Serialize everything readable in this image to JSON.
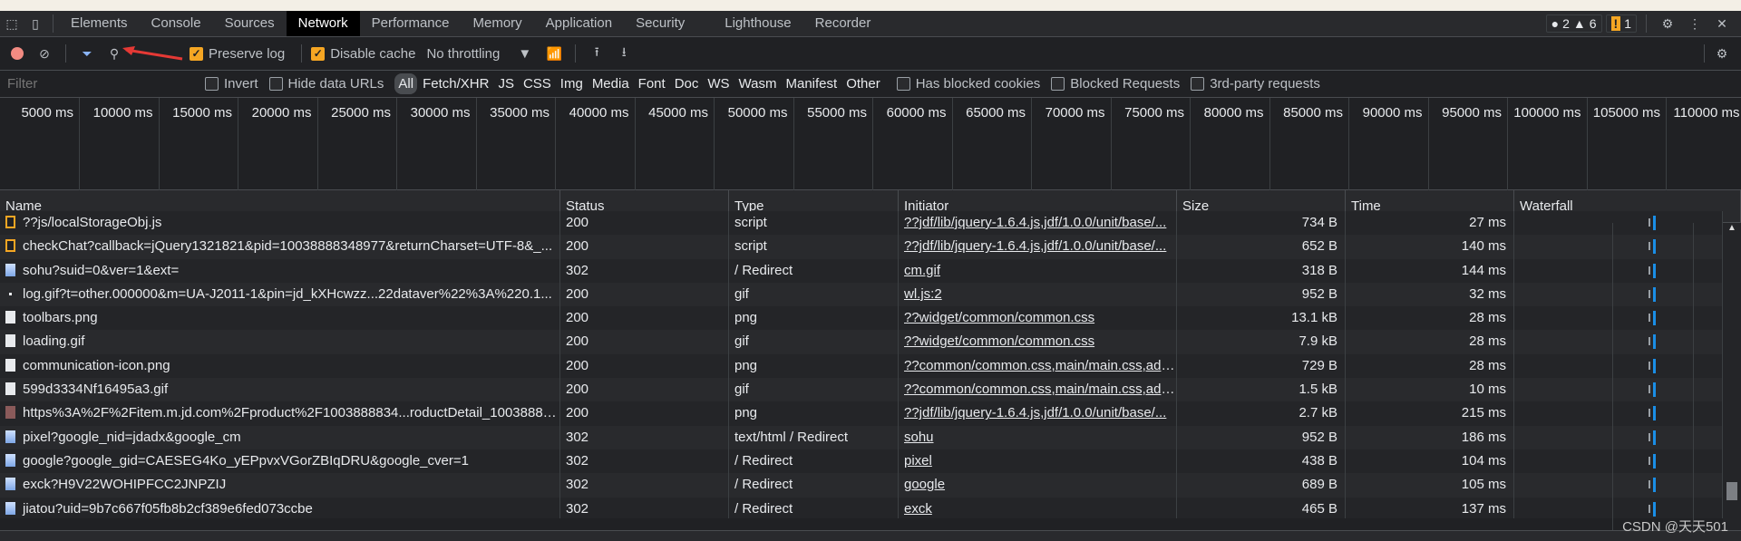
{
  "tabs": [
    {
      "label": "Elements"
    },
    {
      "label": "Console"
    },
    {
      "label": "Sources"
    },
    {
      "label": "Network",
      "active": true
    },
    {
      "label": "Performance"
    },
    {
      "label": "Memory"
    },
    {
      "label": "Application"
    },
    {
      "label": "Security"
    },
    {
      "label": "Lighthouse"
    },
    {
      "label": "Recorder"
    }
  ],
  "badges": {
    "errors": "2",
    "warnings": "6",
    "issues": "1"
  },
  "toolbar": {
    "preserve_log": "Preserve log",
    "preserve_log_checked": true,
    "disable_cache": "Disable cache",
    "disable_cache_checked": true,
    "throttling": "No throttling"
  },
  "filter": {
    "placeholder": "Filter",
    "invert": "Invert",
    "hide_data_urls": "Hide data URLs",
    "types": [
      "All",
      "Fetch/XHR",
      "JS",
      "CSS",
      "Img",
      "Media",
      "Font",
      "Doc",
      "WS",
      "Wasm",
      "Manifest",
      "Other"
    ],
    "has_blocked_cookies": "Has blocked cookies",
    "blocked_requests": "Blocked Requests",
    "third_party": "3rd-party requests"
  },
  "overview_ticks": [
    "5000 ms",
    "10000 ms",
    "15000 ms",
    "20000 ms",
    "25000 ms",
    "30000 ms",
    "35000 ms",
    "40000 ms",
    "45000 ms",
    "50000 ms",
    "55000 ms",
    "60000 ms",
    "65000 ms",
    "70000 ms",
    "75000 ms",
    "80000 ms",
    "85000 ms",
    "90000 ms",
    "95000 ms",
    "100000 ms",
    "105000 ms",
    "110000 ms"
  ],
  "columns": [
    "Name",
    "Status",
    "Type",
    "Initiator",
    "Size",
    "Time",
    "Waterfall"
  ],
  "rows": [
    {
      "icon": "script",
      "name": "??js/localStorageObj.js",
      "status": "200",
      "type": "script",
      "initiator": "??jdf/lib/jquery-1.6.4.js,jdf/1.0.0/unit/base/...",
      "size": "734 B",
      "time": "27 ms"
    },
    {
      "icon": "script",
      "name": "checkChat?callback=jQuery1321821&pid=10038888348977&returnCharset=UTF-8&_...",
      "status": "200",
      "type": "script",
      "initiator": "??jdf/lib/jquery-1.6.4.js,jdf/1.0.0/unit/base/...",
      "size": "652 B",
      "time": "140 ms"
    },
    {
      "icon": "doc",
      "name": "sohu?suid=0&ver=1&ext=",
      "status": "302",
      "type": "/ Redirect",
      "initiator": "cm.gif",
      "size": "318 B",
      "time": "144 ms"
    },
    {
      "icon": "dot",
      "name": "log.gif?t=other.000000&m=UA-J2011-1&pin=jd_kXHcwzz...22dataver%22%3A%220.1...",
      "status": "200",
      "type": "gif",
      "initiator": "wl.js:2",
      "size": "952 B",
      "time": "32 ms"
    },
    {
      "icon": "white",
      "name": "toolbars.png",
      "status": "200",
      "type": "png",
      "initiator": "??widget/common/common.css",
      "size": "13.1 kB",
      "time": "28 ms"
    },
    {
      "icon": "white",
      "name": "loading.gif",
      "status": "200",
      "type": "gif",
      "initiator": "??widget/common/common.css",
      "size": "7.9 kB",
      "time": "28 ms"
    },
    {
      "icon": "white",
      "name": "communication-icon.png",
      "status": "200",
      "type": "png",
      "initiator": "??common/common.css,main/main.css,add...",
      "size": "729 B",
      "time": "28 ms"
    },
    {
      "icon": "white",
      "name": "599d3334Nf16495a3.gif",
      "status": "200",
      "type": "gif",
      "initiator": "??common/common.css,main/main.css,add...",
      "size": "1.5 kB",
      "time": "10 ms"
    },
    {
      "icon": "img",
      "name": "https%3A%2F%2Fitem.m.jd.com%2Fproduct%2F1003888834...roductDetail_10038888...",
      "status": "200",
      "type": "png",
      "initiator": "??jdf/lib/jquery-1.6.4.js,jdf/1.0.0/unit/base/...",
      "size": "2.7 kB",
      "time": "215 ms"
    },
    {
      "icon": "doc",
      "name": "pixel?google_nid=jdadx&google_cm",
      "status": "302",
      "type": "text/html / Redirect",
      "initiator": "sohu",
      "size": "952 B",
      "time": "186 ms"
    },
    {
      "icon": "doc",
      "name": "google?google_gid=CAESEG4Ko_yEPpvxVGorZBIqDRU&google_cver=1",
      "status": "302",
      "type": "/ Redirect",
      "initiator": "pixel",
      "size": "438 B",
      "time": "104 ms"
    },
    {
      "icon": "doc",
      "name": "exck?H9V22WOHIPFCC2JNPZIJ",
      "status": "302",
      "type": "/ Redirect",
      "initiator": "google",
      "size": "689 B",
      "time": "105 ms"
    },
    {
      "icon": "doc",
      "name": "jiatou?uid=9b7c667f05fb8b2cf389e6fed073ccbe",
      "status": "302",
      "type": "/ Redirect",
      "initiator": "exck",
      "size": "465 B",
      "time": "137 ms"
    }
  ],
  "watermark": "CSDN @天天501",
  "colors": {
    "accent": "#1a8ee6",
    "checkbox": "#f5a623",
    "record": "#f28b82"
  }
}
